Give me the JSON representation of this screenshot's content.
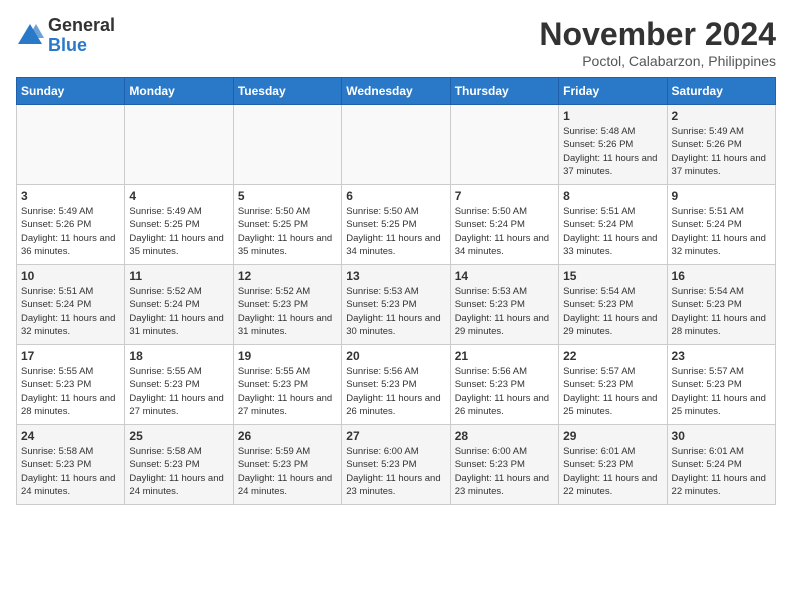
{
  "header": {
    "logo_general": "General",
    "logo_blue": "Blue",
    "month_title": "November 2024",
    "location": "Poctol, Calabarzon, Philippines"
  },
  "weekdays": [
    "Sunday",
    "Monday",
    "Tuesday",
    "Wednesday",
    "Thursday",
    "Friday",
    "Saturday"
  ],
  "weeks": [
    [
      {
        "day": "",
        "info": ""
      },
      {
        "day": "",
        "info": ""
      },
      {
        "day": "",
        "info": ""
      },
      {
        "day": "",
        "info": ""
      },
      {
        "day": "",
        "info": ""
      },
      {
        "day": "1",
        "info": "Sunrise: 5:48 AM\nSunset: 5:26 PM\nDaylight: 11 hours\nand 37 minutes."
      },
      {
        "day": "2",
        "info": "Sunrise: 5:49 AM\nSunset: 5:26 PM\nDaylight: 11 hours\nand 37 minutes."
      }
    ],
    [
      {
        "day": "3",
        "info": "Sunrise: 5:49 AM\nSunset: 5:26 PM\nDaylight: 11 hours\nand 36 minutes."
      },
      {
        "day": "4",
        "info": "Sunrise: 5:49 AM\nSunset: 5:25 PM\nDaylight: 11 hours\nand 35 minutes."
      },
      {
        "day": "5",
        "info": "Sunrise: 5:50 AM\nSunset: 5:25 PM\nDaylight: 11 hours\nand 35 minutes."
      },
      {
        "day": "6",
        "info": "Sunrise: 5:50 AM\nSunset: 5:25 PM\nDaylight: 11 hours\nand 34 minutes."
      },
      {
        "day": "7",
        "info": "Sunrise: 5:50 AM\nSunset: 5:24 PM\nDaylight: 11 hours\nand 34 minutes."
      },
      {
        "day": "8",
        "info": "Sunrise: 5:51 AM\nSunset: 5:24 PM\nDaylight: 11 hours\nand 33 minutes."
      },
      {
        "day": "9",
        "info": "Sunrise: 5:51 AM\nSunset: 5:24 PM\nDaylight: 11 hours\nand 32 minutes."
      }
    ],
    [
      {
        "day": "10",
        "info": "Sunrise: 5:51 AM\nSunset: 5:24 PM\nDaylight: 11 hours\nand 32 minutes."
      },
      {
        "day": "11",
        "info": "Sunrise: 5:52 AM\nSunset: 5:24 PM\nDaylight: 11 hours\nand 31 minutes."
      },
      {
        "day": "12",
        "info": "Sunrise: 5:52 AM\nSunset: 5:23 PM\nDaylight: 11 hours\nand 31 minutes."
      },
      {
        "day": "13",
        "info": "Sunrise: 5:53 AM\nSunset: 5:23 PM\nDaylight: 11 hours\nand 30 minutes."
      },
      {
        "day": "14",
        "info": "Sunrise: 5:53 AM\nSunset: 5:23 PM\nDaylight: 11 hours\nand 29 minutes."
      },
      {
        "day": "15",
        "info": "Sunrise: 5:54 AM\nSunset: 5:23 PM\nDaylight: 11 hours\nand 29 minutes."
      },
      {
        "day": "16",
        "info": "Sunrise: 5:54 AM\nSunset: 5:23 PM\nDaylight: 11 hours\nand 28 minutes."
      }
    ],
    [
      {
        "day": "17",
        "info": "Sunrise: 5:55 AM\nSunset: 5:23 PM\nDaylight: 11 hours\nand 28 minutes."
      },
      {
        "day": "18",
        "info": "Sunrise: 5:55 AM\nSunset: 5:23 PM\nDaylight: 11 hours\nand 27 minutes."
      },
      {
        "day": "19",
        "info": "Sunrise: 5:55 AM\nSunset: 5:23 PM\nDaylight: 11 hours\nand 27 minutes."
      },
      {
        "day": "20",
        "info": "Sunrise: 5:56 AM\nSunset: 5:23 PM\nDaylight: 11 hours\nand 26 minutes."
      },
      {
        "day": "21",
        "info": "Sunrise: 5:56 AM\nSunset: 5:23 PM\nDaylight: 11 hours\nand 26 minutes."
      },
      {
        "day": "22",
        "info": "Sunrise: 5:57 AM\nSunset: 5:23 PM\nDaylight: 11 hours\nand 25 minutes."
      },
      {
        "day": "23",
        "info": "Sunrise: 5:57 AM\nSunset: 5:23 PM\nDaylight: 11 hours\nand 25 minutes."
      }
    ],
    [
      {
        "day": "24",
        "info": "Sunrise: 5:58 AM\nSunset: 5:23 PM\nDaylight: 11 hours\nand 24 minutes."
      },
      {
        "day": "25",
        "info": "Sunrise: 5:58 AM\nSunset: 5:23 PM\nDaylight: 11 hours\nand 24 minutes."
      },
      {
        "day": "26",
        "info": "Sunrise: 5:59 AM\nSunset: 5:23 PM\nDaylight: 11 hours\nand 24 minutes."
      },
      {
        "day": "27",
        "info": "Sunrise: 6:00 AM\nSunset: 5:23 PM\nDaylight: 11 hours\nand 23 minutes."
      },
      {
        "day": "28",
        "info": "Sunrise: 6:00 AM\nSunset: 5:23 PM\nDaylight: 11 hours\nand 23 minutes."
      },
      {
        "day": "29",
        "info": "Sunrise: 6:01 AM\nSunset: 5:23 PM\nDaylight: 11 hours\nand 22 minutes."
      },
      {
        "day": "30",
        "info": "Sunrise: 6:01 AM\nSunset: 5:24 PM\nDaylight: 11 hours\nand 22 minutes."
      }
    ]
  ]
}
